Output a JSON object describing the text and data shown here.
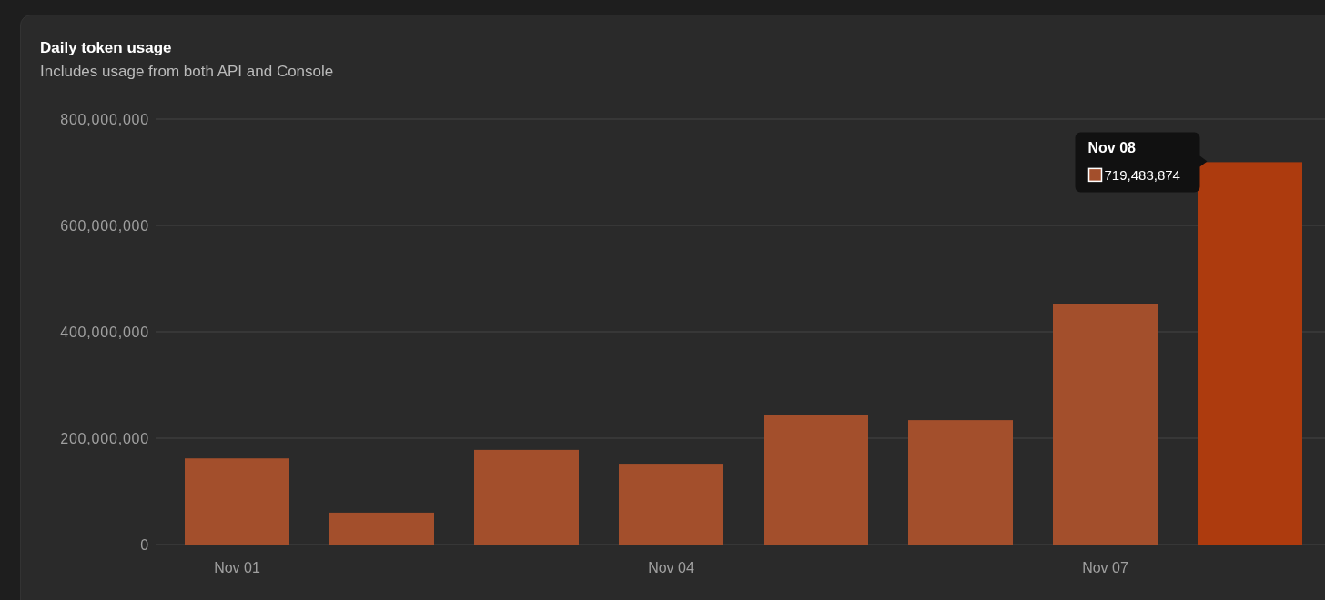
{
  "card": {
    "title": "Daily token usage",
    "subtitle": "Includes usage from both API and Console",
    "chart_data": {
      "type": "bar",
      "categories": [
        "Nov 01",
        null,
        null,
        "Nov 04",
        null,
        null,
        "Nov 07",
        null
      ],
      "series": [
        {
          "color": "#a34f2c",
          "values": [
            162000000,
            60000000,
            178000000,
            152000000,
            243000000,
            234000000,
            453000000,
            null
          ]
        },
        {
          "color": "#ad3b0e",
          "values": [
            null,
            null,
            null,
            null,
            null,
            null,
            null,
            719000000
          ]
        }
      ],
      "stacked": true,
      "ylim": [
        0,
        800000000
      ],
      "grid": true,
      "yticks": [
        {
          "value": 0,
          "label": "0"
        },
        {
          "value": 200000000,
          "label": "200,000,000"
        },
        {
          "value": 400000000,
          "label": "400,000,000"
        },
        {
          "value": 600000000,
          "label": "600,000,000"
        },
        {
          "value": 800000000,
          "label": "800,000,000"
        }
      ]
    },
    "tooltip": {
      "title": "Nov 08",
      "value": "719,483,874"
    }
  }
}
